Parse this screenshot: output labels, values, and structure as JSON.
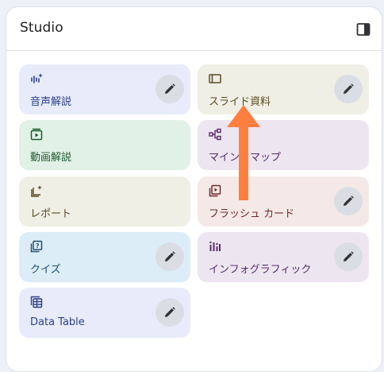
{
  "panel": {
    "title": "Studio"
  },
  "cards": {
    "audio_overview": {
      "label": "音声解説"
    },
    "slides": {
      "label": "スライド資料"
    },
    "video_overview": {
      "label": "動画解説"
    },
    "mind_map": {
      "label": "マインドマップ"
    },
    "report": {
      "label": "レポート"
    },
    "flashcards": {
      "label": "フラッシュ カード"
    },
    "quiz": {
      "label": "クイズ"
    },
    "infographic": {
      "label": "インフォグラフィック"
    },
    "data_table": {
      "label": "Data Table"
    }
  },
  "colors": {
    "background": "#eef0f8",
    "panel": "#ffffff",
    "card_blue_bg": "#e8ecfa",
    "card_blue_text": "#2c3f8a",
    "card_beige_bg": "#f0efe6",
    "card_beige_text": "#5b4a22",
    "card_green_bg": "#e1f1e6",
    "card_green_text": "#1e5a2e",
    "card_purple_bg": "#ede6f1",
    "card_purple_text": "#5a2a6e",
    "card_pink_bg": "#f4e9e7",
    "card_pink_text": "#6e2a2a",
    "card_cyan_bg": "#dcedf7",
    "card_cyan_text": "#1f4e6e",
    "arrow": "#ff7f3f"
  },
  "icons": {
    "audio": "audio-wave-sparkle-icon",
    "slides": "slides-icon",
    "video": "video-play-icon",
    "mind_map": "mind-map-icon",
    "report": "report-sparkle-icon",
    "flashcards": "flashcards-icon",
    "quiz": "quiz-icon",
    "infographic": "infographic-icon",
    "data_table": "table-icon",
    "edit": "pencil-icon",
    "panel_toggle": "side-panel-icon"
  }
}
